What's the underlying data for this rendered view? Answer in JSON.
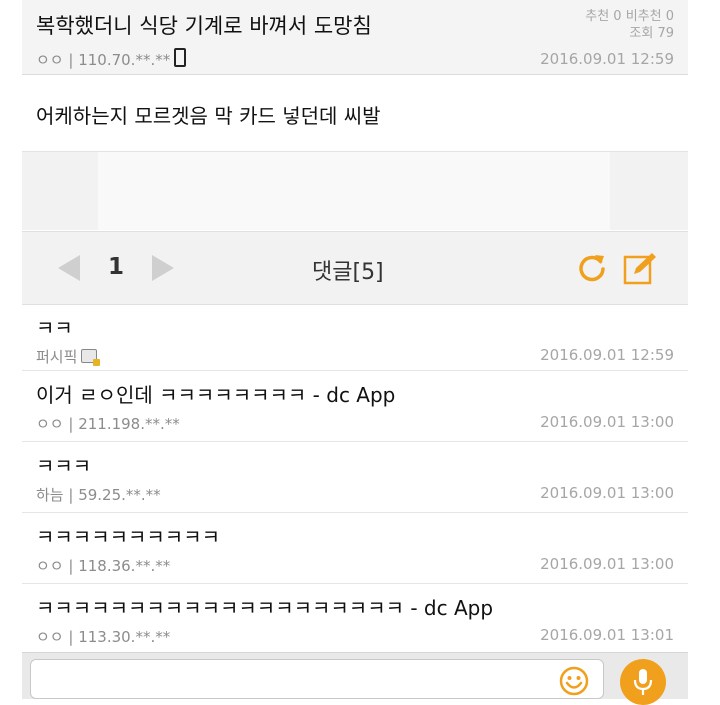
{
  "post": {
    "title": "복학했더니 식당 기계로 바껴서 도망침",
    "author": "ㅇㅇ | 110.70.**.**",
    "recommend": "추천 0 비추천 0",
    "views": "조회 79",
    "date": "2016.09.01 12:59",
    "body": "어케하는지 모르겟음 막 카드 넣던데 씨발"
  },
  "comment_bar": {
    "page": "1",
    "title": "댓글[5]"
  },
  "comments": [
    {
      "text": "ㅋㅋ",
      "author": "퍼시픽",
      "date": "2016.09.01 12:59"
    },
    {
      "text": "이거 ㄹㅇ인데 ㅋㅋㅋㅋㅋㅋㅋㅋ  - dc App",
      "author": "ㅇㅇ | 211.198.**.**",
      "date": "2016.09.01 13:00"
    },
    {
      "text": "ㅋㅋㅋ",
      "author": "하늠 | 59.25.**.**",
      "date": "2016.09.01 13:00"
    },
    {
      "text": "ㅋㅋㅋㅋㅋㅋㅋㅋㅋㅋ",
      "author": "ㅇㅇ | 118.36.**.**",
      "date": "2016.09.01 13:00"
    },
    {
      "text": "ㅋㅋㅋㅋㅋㅋㅋㅋㅋㅋㅋㅋㅋㅋㅋㅋㅋㅋㅋㅋ  - dc App",
      "author": "ㅇㅇ | 113.30.**.**",
      "date": "2016.09.01 13:01"
    }
  ],
  "input": {
    "value": "",
    "placeholder": ""
  },
  "icons": {
    "phone": "mobile-phone-icon",
    "gallery": "gallery-badge-icon",
    "refresh": "refresh-icon",
    "write": "write-icon",
    "emoji": "emoji-icon",
    "mic": "mic-icon"
  },
  "colors": {
    "accent": "#f0a01c",
    "meta_text": "#8c8c8c"
  }
}
